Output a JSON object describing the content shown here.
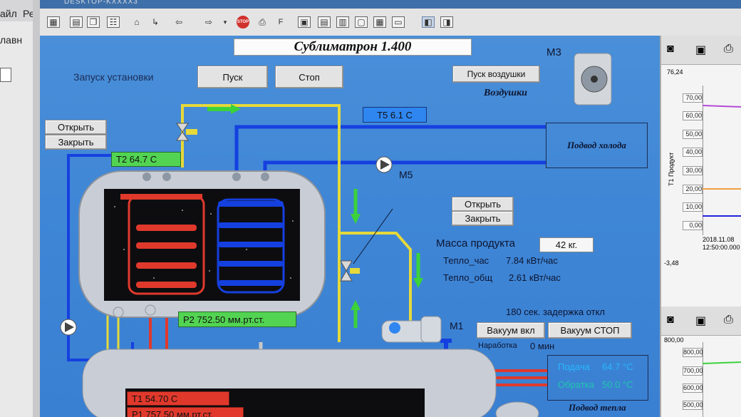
{
  "desktop": {
    "left_labels": [
      "айл",
      "лавн"
    ],
    "top_tab_label": "Ре"
  },
  "window": {
    "title_fragment": "DESKTOP-KXXXX3"
  },
  "toolbar": {
    "icons": [
      "save-icon",
      "new-icon",
      "copy-icon",
      "hierarchy-icon",
      "home-icon",
      "tree-icon",
      "back-icon",
      "forward-icon",
      "stop-icon",
      "print-icon",
      "font-icon",
      "export-icon",
      "table-icon",
      "image-icon",
      "window-icon",
      "screen-icon",
      "layout-icon",
      "mode-icon"
    ],
    "stop_text": "STOP",
    "font_text": "F"
  },
  "scada": {
    "title": "Сублиматрон 1.400",
    "launch_label": "Запуск установки",
    "start_button": "Пуск",
    "stop_button": "Стоп",
    "air_button": "Пуск воздушки",
    "air_label": "Воздушки",
    "m3_label": "M3",
    "t5": "T5   6.1 C",
    "cold_supply": "Подвод холода",
    "open_button_left": "Открыть",
    "close_button_left": "Закрыть",
    "t2": "T2      64.7 C",
    "m5_label": "M5",
    "open_button_mid": "Открыть",
    "close_button_mid": "Закрыть",
    "mass_label": "Масса продукта",
    "mass_value": "42 кг.",
    "heat_hour_label": "Тепло_час",
    "heat_hour_value": "7.84 кВт/час",
    "heat_total_label": "Тепло_общ",
    "heat_total_value": "2.61 кВт/час",
    "p2": "P2     752.50 мм.рт.ст.",
    "delay_text": "180 сек. задержка откл",
    "m1_label": "M1",
    "vac_on_button": "Вакуум вкл",
    "vac_stop_button": "Вакуум СТОП",
    "runtime_label": "Наработка",
    "runtime_value": "0 мин",
    "supply_label": "Подача",
    "supply_value": "64.7 °C",
    "return_label": "Обратка",
    "return_value": "50.0 °C",
    "heat_supply": "Подвод тепла",
    "t1": "T1    54.70 C",
    "p1": "P1    757.50 мм.рт.ст."
  },
  "trend1": {
    "current": "76,24",
    "ylabel": "T1 Продукт",
    "ticks": [
      "70,00",
      "60,00",
      "50,00",
      "40,00",
      "30,00",
      "20,00",
      "10,00",
      "0,00"
    ],
    "date": "2018.11.08",
    "time": "12:50:00.000",
    "min": "-3,48"
  },
  "trend2": {
    "current": "800,00",
    "ticks": [
      "800,00",
      "700,00",
      "600,00",
      "500,00"
    ]
  },
  "colors": {
    "accent_blue": "#2b6fd0",
    "pipe_cold": "#1540e0",
    "pipe_hot": "#e0392c",
    "pipe_yellow": "#e6d93a",
    "readout_green": "#52d452",
    "readout_red": "#e0392c",
    "readout_blue": "#2f86f0"
  }
}
